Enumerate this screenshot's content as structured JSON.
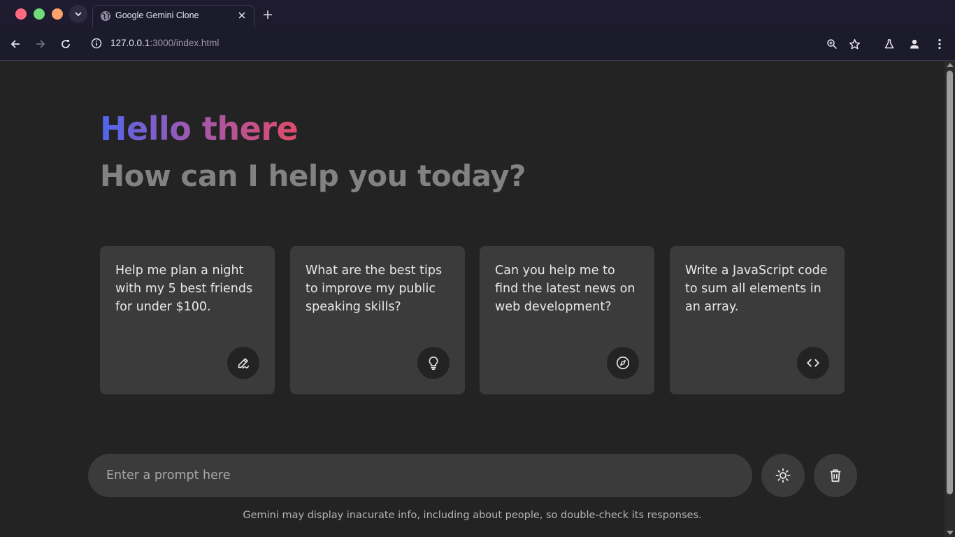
{
  "browser": {
    "tab_title": "Google Gemini Clone",
    "url_host": "127.0.0.1",
    "url_rest": ":3000/index.html"
  },
  "header": {
    "greeting": "Hello there",
    "subtitle": "How can I help you today?"
  },
  "suggestions": [
    {
      "text": "Help me plan a night with my 5 best friends for under $100.",
      "icon": "draw-icon"
    },
    {
      "text": "What are the best tips to improve my public speaking skills?",
      "icon": "lightbulb-icon"
    },
    {
      "text": "Can you help me to find the latest news on web development?",
      "icon": "explore-icon"
    },
    {
      "text": "Write a JavaScript code to sum all elements in an array.",
      "icon": "code-icon"
    }
  ],
  "prompt": {
    "placeholder": "Enter a prompt here",
    "value": ""
  },
  "actions": {
    "theme_icon": "light-mode-icon",
    "delete_icon": "delete-icon"
  },
  "footer": {
    "disclaimer": "Gemini may display inacurate info, including about people, so double-check its responses."
  },
  "colors": {
    "greeting_gradient": [
      "#4f66ee",
      "#9c59b3",
      "#e04c6a"
    ],
    "background": "#232323",
    "card": "#3b3b3b"
  }
}
